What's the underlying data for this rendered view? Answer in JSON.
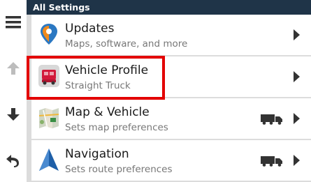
{
  "header": {
    "title": "All Settings"
  },
  "rail": [
    {
      "icon": "menu-icon"
    },
    {
      "icon": "arrow-up-icon"
    },
    {
      "icon": "arrow-down-icon"
    },
    {
      "icon": "back-icon"
    }
  ],
  "items": [
    {
      "title": "Updates",
      "subtitle": "Maps, software, and more",
      "icon": "map-pin-update-icon",
      "truck": false
    },
    {
      "title": "Vehicle Profile",
      "subtitle": "Straight Truck",
      "icon": "truck-profile-icon",
      "truck": false,
      "highlighted": true
    },
    {
      "title": "Map & Vehicle",
      "subtitle": "Sets map preferences",
      "icon": "map-icon",
      "truck": true
    },
    {
      "title": "Navigation",
      "subtitle": "Sets route preferences",
      "icon": "navigation-arrow-icon",
      "truck": true
    }
  ],
  "colors": {
    "header_bg": "#1f3448",
    "highlight": "#e30000",
    "accent_blue": "#1e5fa8"
  }
}
